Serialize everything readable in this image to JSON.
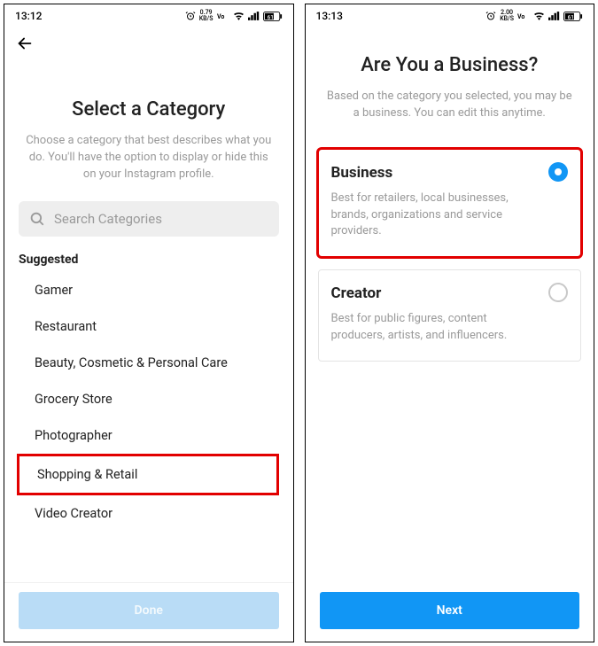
{
  "left": {
    "status": {
      "time": "13:12",
      "speed_top": "0.79",
      "speed_bot": "KB/S",
      "battery": "61"
    },
    "title": "Select a Category",
    "subtitle": "Choose a category that best describes what you do. You'll have the option to display or hide this on your Instagram profile.",
    "search_placeholder": "Search Categories",
    "suggested_label": "Suggested",
    "categories": [
      {
        "label": "Gamer"
      },
      {
        "label": "Restaurant"
      },
      {
        "label": "Beauty, Cosmetic & Personal Care"
      },
      {
        "label": "Grocery Store"
      },
      {
        "label": "Photographer"
      },
      {
        "label": "Shopping & Retail",
        "highlighted": true
      },
      {
        "label": "Video Creator"
      }
    ],
    "done_label": "Done"
  },
  "right": {
    "status": {
      "time": "13:13",
      "speed_top": "2.00",
      "speed_bot": "KB/S",
      "battery": "61"
    },
    "title": "Are You a Business?",
    "subtitle": "Based on the category you selected, you may be a business. You can edit this anytime.",
    "options": [
      {
        "title": "Business",
        "desc": "Best for retailers, local businesses, brands, organizations and service providers.",
        "selected": true,
        "highlighted": true
      },
      {
        "title": "Creator",
        "desc": "Best for public figures, content producers, artists, and influencers.",
        "selected": false,
        "highlighted": false
      }
    ],
    "next_label": "Next"
  }
}
